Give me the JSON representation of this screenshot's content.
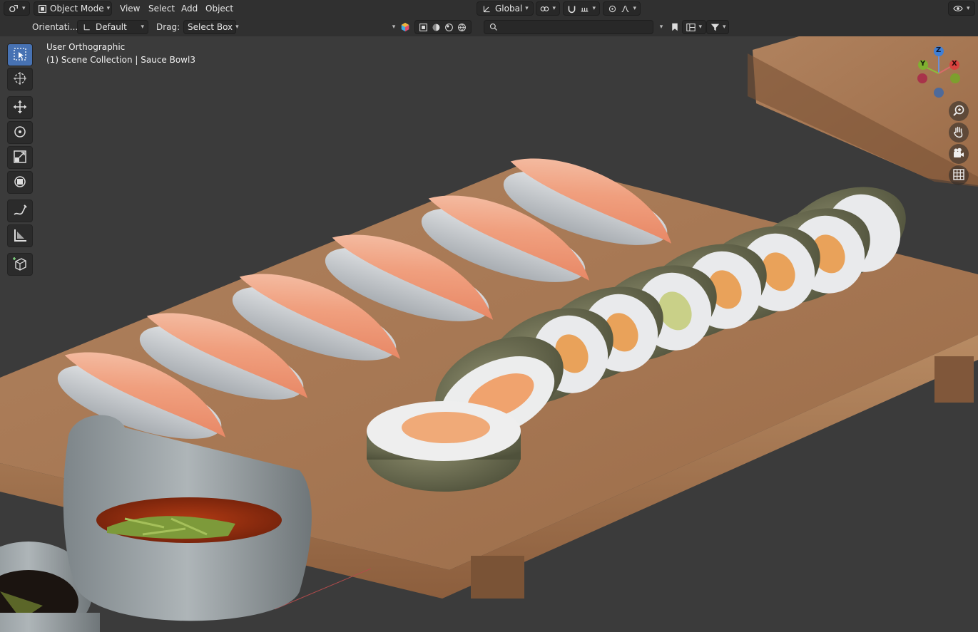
{
  "header": {
    "mode_label": "Object Mode",
    "menus": [
      "View",
      "Select",
      "Add",
      "Object"
    ],
    "transform_orientation": "Global"
  },
  "toolbar": {
    "orientation_label": "Orientati...",
    "orientation_value": "Default",
    "drag_label": "Drag:",
    "drag_value": "Select Box"
  },
  "viewport": {
    "view_name": "User Orthographic",
    "collection_info": "(1) Scene Collection | Sauce Bowl3"
  },
  "gizmo": {
    "x": "X",
    "y": "Y",
    "z": "Z"
  },
  "icons": {
    "editor_type": "editor-type-icon",
    "mode": "object-mode-icon",
    "search": "search-icon",
    "tools": [
      "select-box-icon",
      "cursor-icon",
      "move-icon",
      "rotate-icon",
      "scale-icon",
      "transform-icon",
      "annotate-icon",
      "measure-icon",
      "add-cube-icon"
    ],
    "nav": [
      "zoom-icon",
      "pan-hand-icon",
      "camera-icon",
      "grid-icon"
    ]
  },
  "colors": {
    "accent": "#4772b3",
    "header_bg": "#303030",
    "viewport_bg": "#3b3b3b"
  }
}
